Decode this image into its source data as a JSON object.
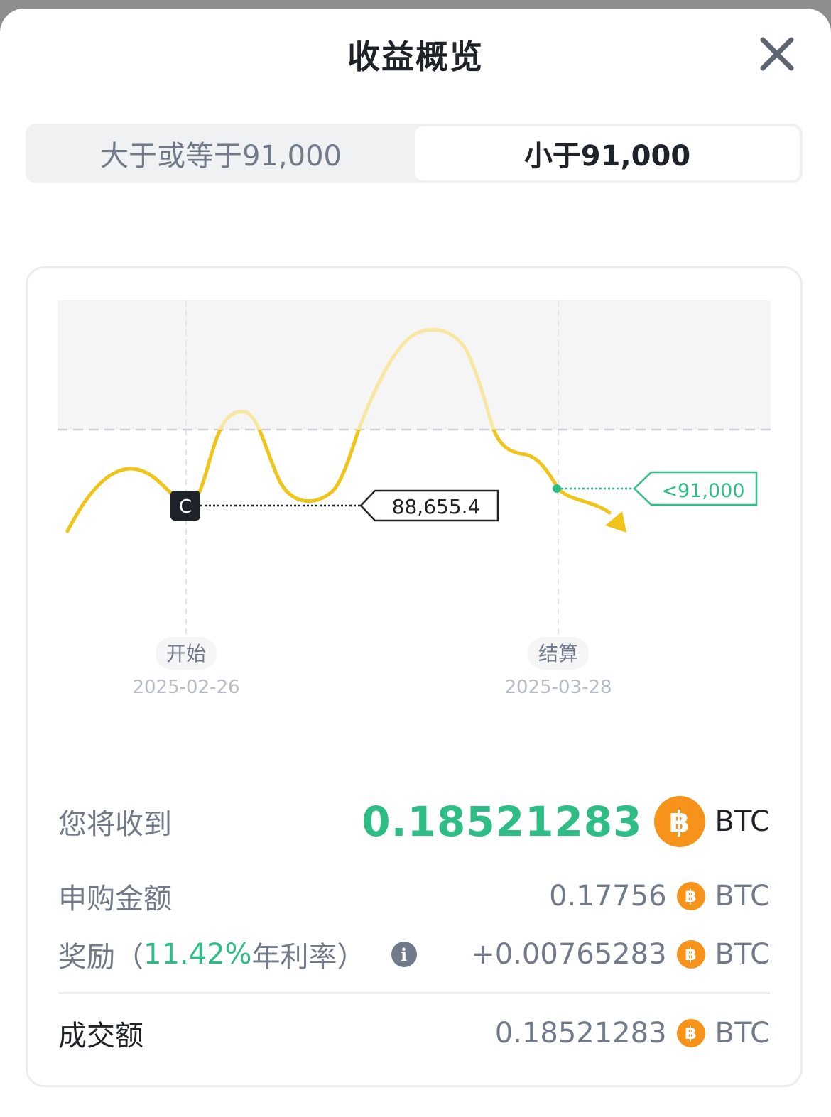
{
  "header": {
    "title": "收益概览",
    "close_icon": "close-icon"
  },
  "tabs": [
    {
      "label": "大于或等于91,000",
      "selected": false
    },
    {
      "label": "小于91,000",
      "selected": true
    }
  ],
  "chart_data": {
    "type": "line",
    "strike_label": "<91,000",
    "start_price_marker": "C",
    "start_price_label": "88,655.4",
    "start": {
      "label": "开始",
      "date": "2025-02-26"
    },
    "settle": {
      "label": "结算",
      "date": "2025-03-28"
    },
    "series_color": "#f0c419",
    "strike_color": "#2ebd85"
  },
  "summary": {
    "receive_label": "您将收到",
    "receive_amount": "0.18521283",
    "receive_unit": "BTC",
    "subscribe_label": "申购金额",
    "subscribe_amount": "0.17756",
    "subscribe_unit": "BTC",
    "reward_label_prefix": "奖励（",
    "reward_rate": "11.42%",
    "reward_label_suffix": " 年利率）",
    "reward_amount": "+0.00765283",
    "reward_unit": "BTC",
    "total_label": "成交额",
    "total_amount": "0.18521283",
    "total_unit": "BTC",
    "coin_glyph": "฿",
    "coin_color": "#f7931a",
    "accent_color": "#2ebd85"
  }
}
